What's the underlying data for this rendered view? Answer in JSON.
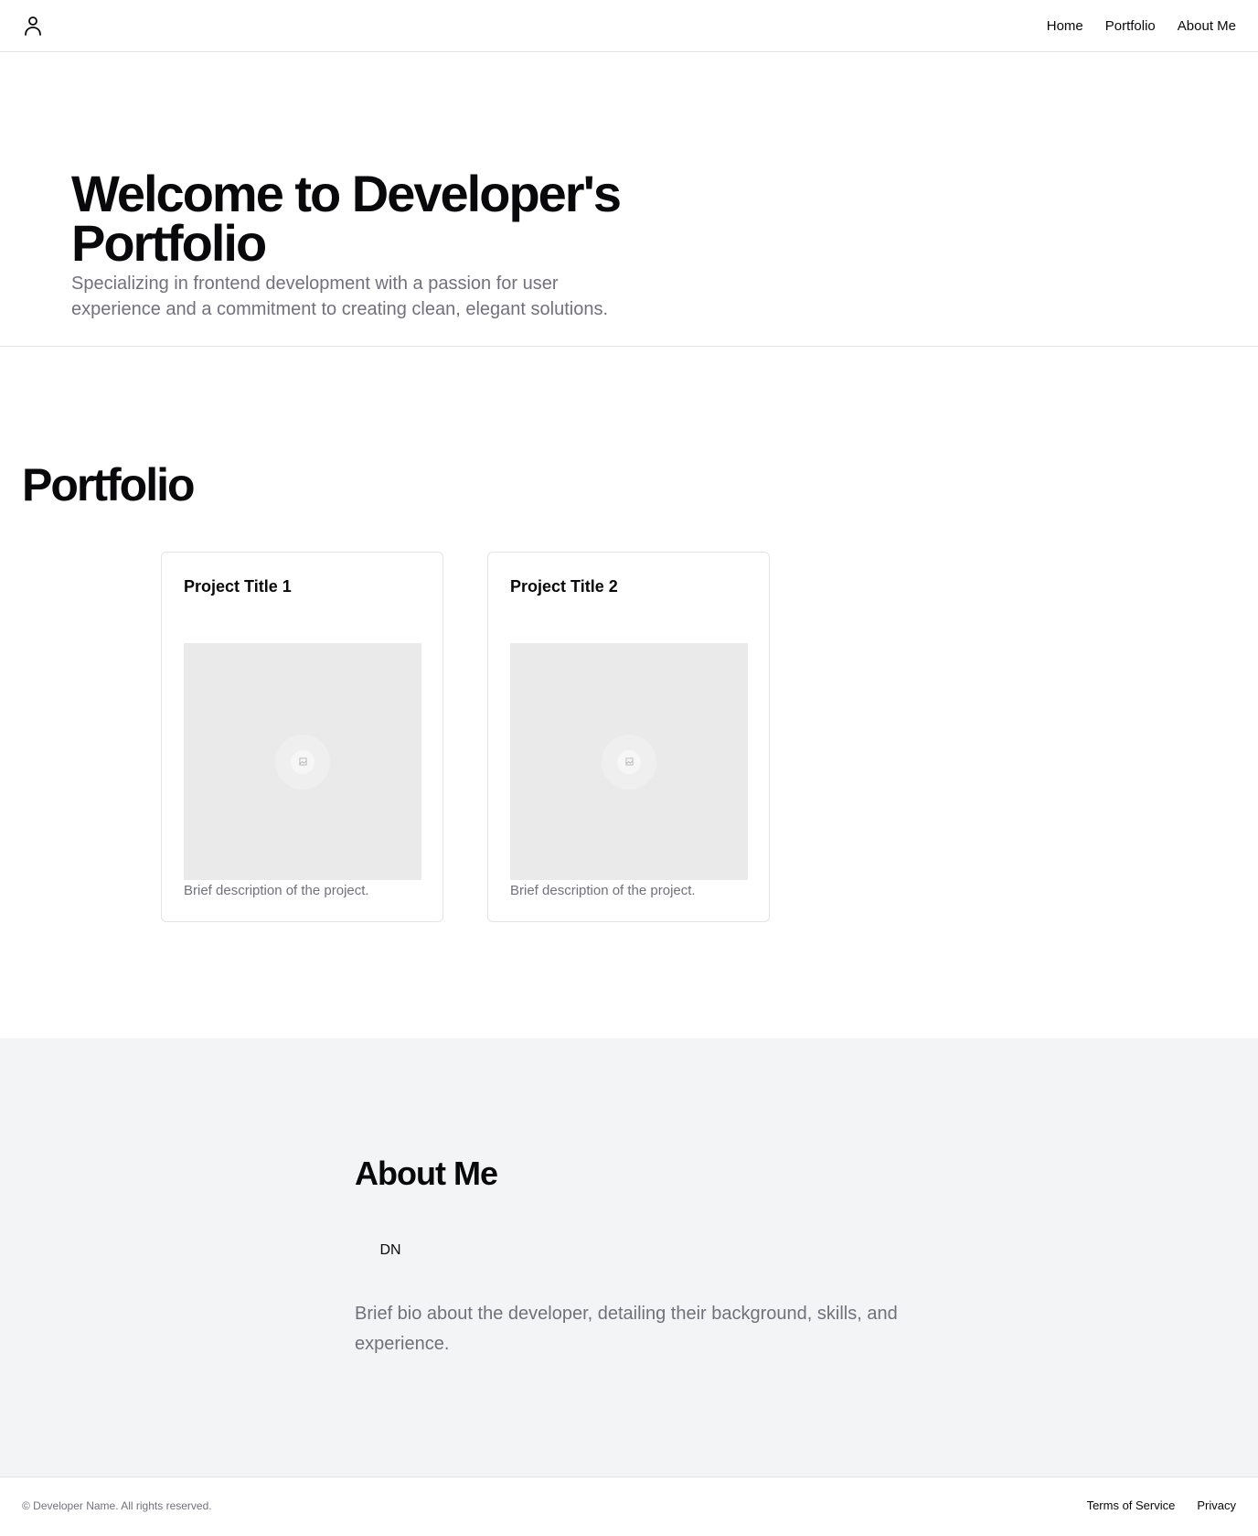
{
  "header": {
    "logo_icon": "user-icon",
    "nav": [
      "Home",
      "Portfolio",
      "About Me"
    ]
  },
  "hero": {
    "title": "Welcome to Developer's Portfolio",
    "subtitle": "Specializing in frontend development with a passion for user experience and a commitment to creating clean, elegant solutions."
  },
  "portfolio": {
    "title": "Portfolio",
    "projects": [
      {
        "title": "Project Title 1",
        "description": "Brief description of the project.",
        "image_icon": "image-placeholder-icon"
      },
      {
        "title": "Project Title 2",
        "description": "Brief description of the project.",
        "image_icon": "image-placeholder-icon"
      }
    ]
  },
  "about": {
    "title": "About Me",
    "avatar_initials": "DN",
    "bio": "Brief bio about the developer, detailing their background, skills, and experience."
  },
  "footer": {
    "copyright": "© Developer Name. All rights reserved.",
    "links": [
      "Terms of Service",
      "Privacy"
    ]
  }
}
